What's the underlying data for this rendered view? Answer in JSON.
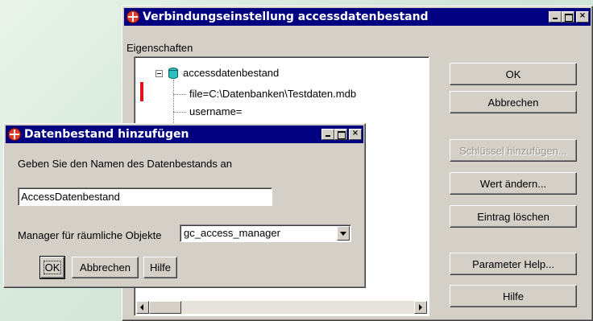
{
  "main_dialog": {
    "title": "Verbindungseinstellung accessdatenbestand",
    "group_label": "Eigenschaften",
    "tree": {
      "root": "accessdatenbestand",
      "children": [
        "file=C:\\Datenbanken\\Testdaten.mdb",
        "username=",
        "..."
      ]
    },
    "buttons": {
      "ok": "OK",
      "cancel": "Abbrechen",
      "add_key": "Schlüssel hinzufügen...",
      "change_value": "Wert ändern...",
      "delete_entry": "Eintrag löschen",
      "parameter_help": "Parameter Help...",
      "help": "Hilfe"
    }
  },
  "sub_dialog": {
    "title": "Datenbestand hinzufügen",
    "prompt": "Geben Sie den Namen des Datenbestands an",
    "name_value": "AccessDatenbestand",
    "manager_label": "Manager für räumliche Objekte",
    "manager_value": "gc_access_manager",
    "buttons": {
      "ok": "OK",
      "cancel": "Abbrechen",
      "help": "Hilfe"
    }
  },
  "colors": {
    "titlebar": "#000080",
    "face": "#d4d0c8",
    "marker": "#e3131b"
  },
  "icons": {
    "title": "app-cross-icon",
    "tree_node": "database-icon"
  }
}
